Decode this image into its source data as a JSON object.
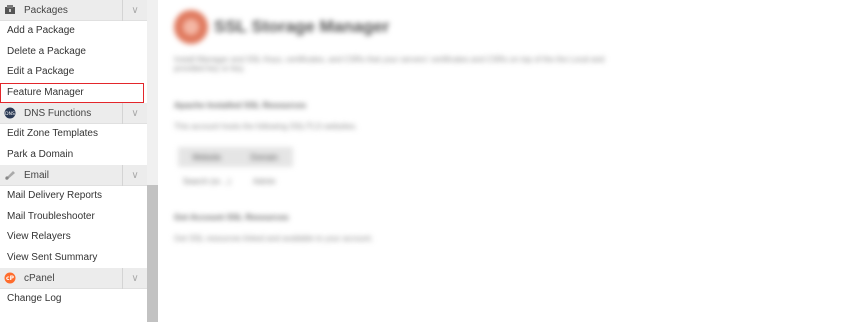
{
  "sidebar": {
    "packages": {
      "header": "Packages",
      "items": [
        "Add a Package",
        "Delete a Package",
        "Edit a Package",
        "Feature Manager"
      ],
      "selected_index": 3
    },
    "dns": {
      "header": "DNS Functions",
      "items": [
        "Edit Zone Templates",
        "Park a Domain"
      ]
    },
    "email": {
      "header": "Email",
      "items": [
        "Mail Delivery Reports",
        "Mail Troubleshooter",
        "View Relayers",
        "View Sent Summary"
      ]
    },
    "cpanel": {
      "header": "cPanel",
      "items": [
        "Change Log"
      ]
    },
    "collapse_glyph": "∨",
    "selected_border_color": "#e3262b"
  },
  "content": {
    "title": "SSL Storage Manager",
    "intro": "Install Manager and SSL Keys, certificates, and CSRs that your servers' certificates and CSRs on top of the the Local and provided key or key.",
    "section1_title": "Apache Installed SSL Resources",
    "section1_text": "This account hosts the following SSL/TLS websites.",
    "table": {
      "headers": [
        "Website",
        "Domain"
      ],
      "row": [
        "Search (or…)",
        "Admin"
      ]
    },
    "section2_title": "Get Account SSL Resources",
    "section2_text": "Get SSL resources linked and available to your account."
  }
}
